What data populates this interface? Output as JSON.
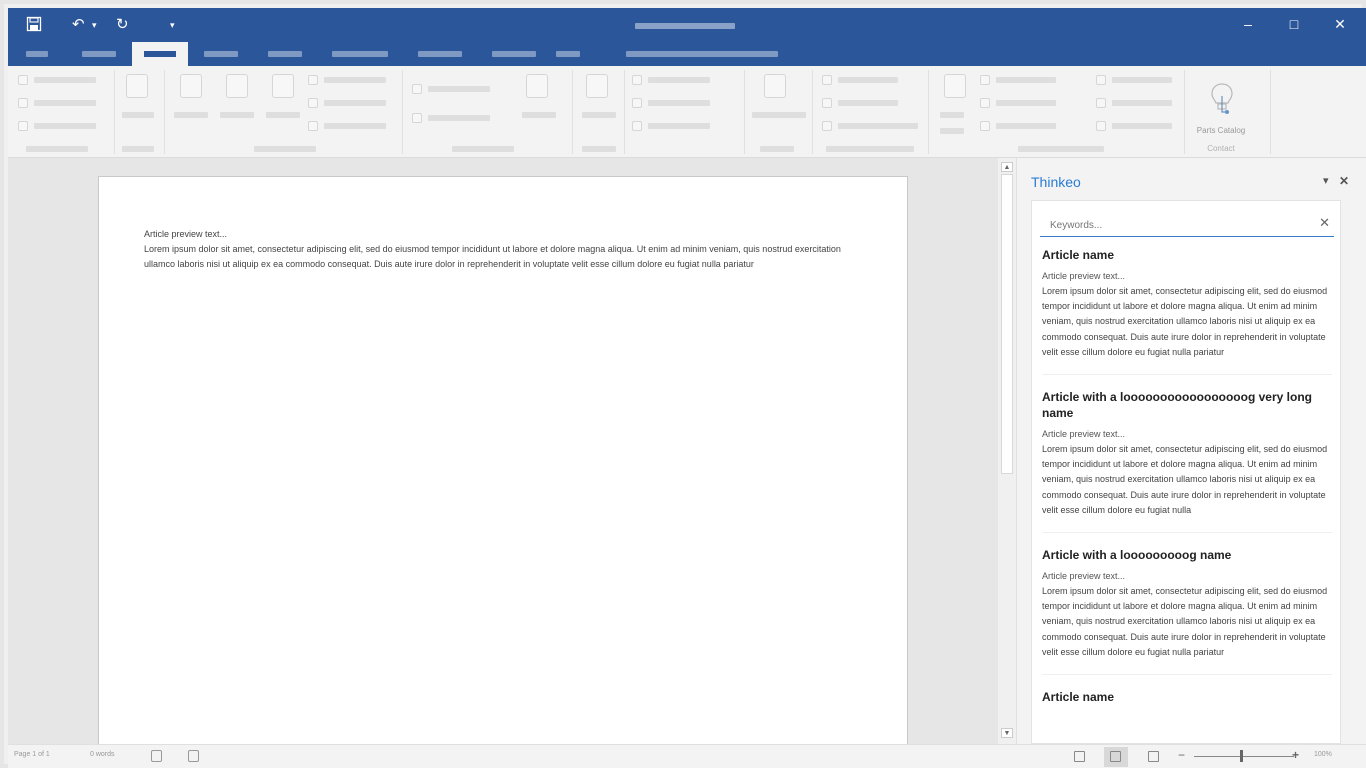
{
  "window": {
    "title_placeholder": "",
    "minimize_glyph": "–",
    "maximize_glyph": "□",
    "close_glyph": "✕"
  },
  "quick_access": {
    "save_glyph": "💾",
    "undo_glyph": "↶",
    "undo_dropdown_glyph": "▾",
    "redo_glyph": "↻",
    "customize_glyph": "▾"
  },
  "ribbon": {
    "parts_catalog_label": "Parts Catalog",
    "parts_catalog_group": "Contact"
  },
  "document": {
    "preview_line": "Article preview text...",
    "body": "Lorem ipsum dolor sit amet, consectetur adipiscing elit, sed do eiusmod tempor incididunt ut labore et dolore magna aliqua. Ut enim ad minim veniam, quis nostrud exercitation ullamco laboris nisi ut aliquip ex ea commodo consequat. Duis aute irure dolor in reprehenderit in voluptate velit esse cillum dolore eu fugiat nulla pariatur"
  },
  "scrollbar": {
    "up_glyph": "▲",
    "down_glyph": "▼"
  },
  "pane": {
    "title": "Thinkeo",
    "dropdown_glyph": "▾",
    "close_glyph": "✕",
    "search": {
      "placeholder": "Keywords...",
      "value": "",
      "clear_glyph": "✕"
    },
    "articles": [
      {
        "title": "Article name",
        "preview": "Article preview text...",
        "body": "Lorem ipsum dolor sit amet, consectetur adipiscing elit, sed do eiusmod tempor incididunt ut labore et dolore magna aliqua. Ut enim ad minim veniam, quis nostrud exercitation ullamco laboris nisi ut aliquip ex ea commodo consequat. Duis aute irure dolor in reprehenderit in voluptate velit esse cillum dolore eu fugiat nulla pariatur"
      },
      {
        "title": "Article with a looooooooooooooooog very long name",
        "preview": "Article preview text...",
        "body": "Lorem ipsum dolor sit amet, consectetur adipiscing elit, sed do eiusmod tempor incididunt ut labore et dolore magna aliqua. Ut enim ad minim veniam, quis nostrud exercitation ullamco laboris nisi ut aliquip ex ea commodo consequat. Duis aute irure dolor in reprehenderit in voluptate velit esse cillum dolore eu fugiat nulla"
      },
      {
        "title": "Article with a looooooooog name",
        "preview": "Article preview text...",
        "body": "Lorem ipsum dolor sit amet, consectetur adipiscing elit, sed do eiusmod tempor incididunt ut labore et dolore magna aliqua. Ut enim ad minim veniam, quis nostrud exercitation ullamco laboris nisi ut aliquip ex ea commodo consequat. Duis aute irure dolor in reprehenderit in voluptate velit esse cillum dolore eu fugiat nulla pariatur"
      },
      {
        "title": "Article name",
        "preview": "",
        "body": ""
      }
    ]
  },
  "status": {
    "page": "Page 1 of 1",
    "words": "0 words",
    "zoom_minus": "−",
    "zoom_plus": "+",
    "zoom_percent": "100%"
  },
  "colors": {
    "brand": "#2b579a",
    "pane_title": "#2b7cd3"
  }
}
